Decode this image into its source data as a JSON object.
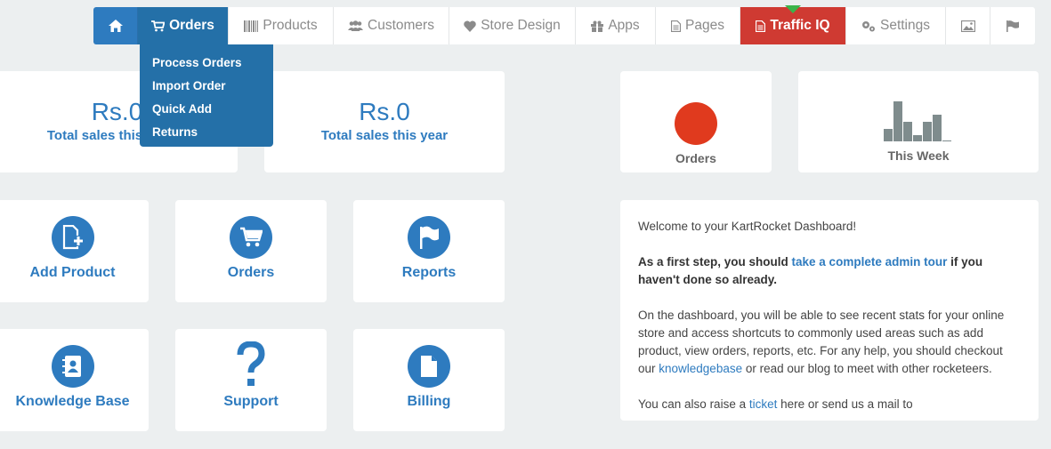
{
  "nav": {
    "orders": "Orders",
    "products": "Products",
    "customers": "Customers",
    "store_design": "Store Design",
    "apps": "Apps",
    "pages": "Pages",
    "traffic_iq": "Traffic IQ",
    "settings": "Settings"
  },
  "dropdown": {
    "items": [
      "Process Orders",
      "Import Order",
      "Quick Add",
      "Returns"
    ]
  },
  "stats": {
    "month_value": "Rs.0",
    "month_label": "Total sales this month",
    "year_value": "Rs.0",
    "year_label": "Total sales this year",
    "orders_label": "Orders",
    "week_label": "This Week"
  },
  "week_bars": [
    14,
    45,
    22,
    7,
    22,
    30,
    1
  ],
  "tiles": {
    "add_product": "Add Product",
    "orders": "Orders",
    "reports": "Reports",
    "knowledge_base": "Knowledge Base",
    "support": "Support",
    "billing": "Billing"
  },
  "welcome": {
    "greeting": "Welcome to your KartRocket Dashboard!",
    "step_pre": "As a first step, you should ",
    "step_link": "take a complete admin tour",
    "step_post": " if you haven't done so already.",
    "info_pre": "On the dashboard, you will be able to see recent stats for your online store and access shortcuts to commonly used areas such as add product, view orders, reports, etc. For any help, you should checkout our ",
    "info_link": "knowledgebase",
    "info_post": " or read our blog to meet with other rocketeers.",
    "last_pre": "You can also raise a ",
    "last_link": "ticket",
    "last_post": " here or send us a mail to"
  },
  "colors": {
    "primary": "#2e7bbf",
    "orders_dark": "#2470a8",
    "traffic": "#cf3a32",
    "orders_dot": "#e03a1e",
    "bar": "#7f8c8d",
    "indicator": "#3bb44a"
  }
}
